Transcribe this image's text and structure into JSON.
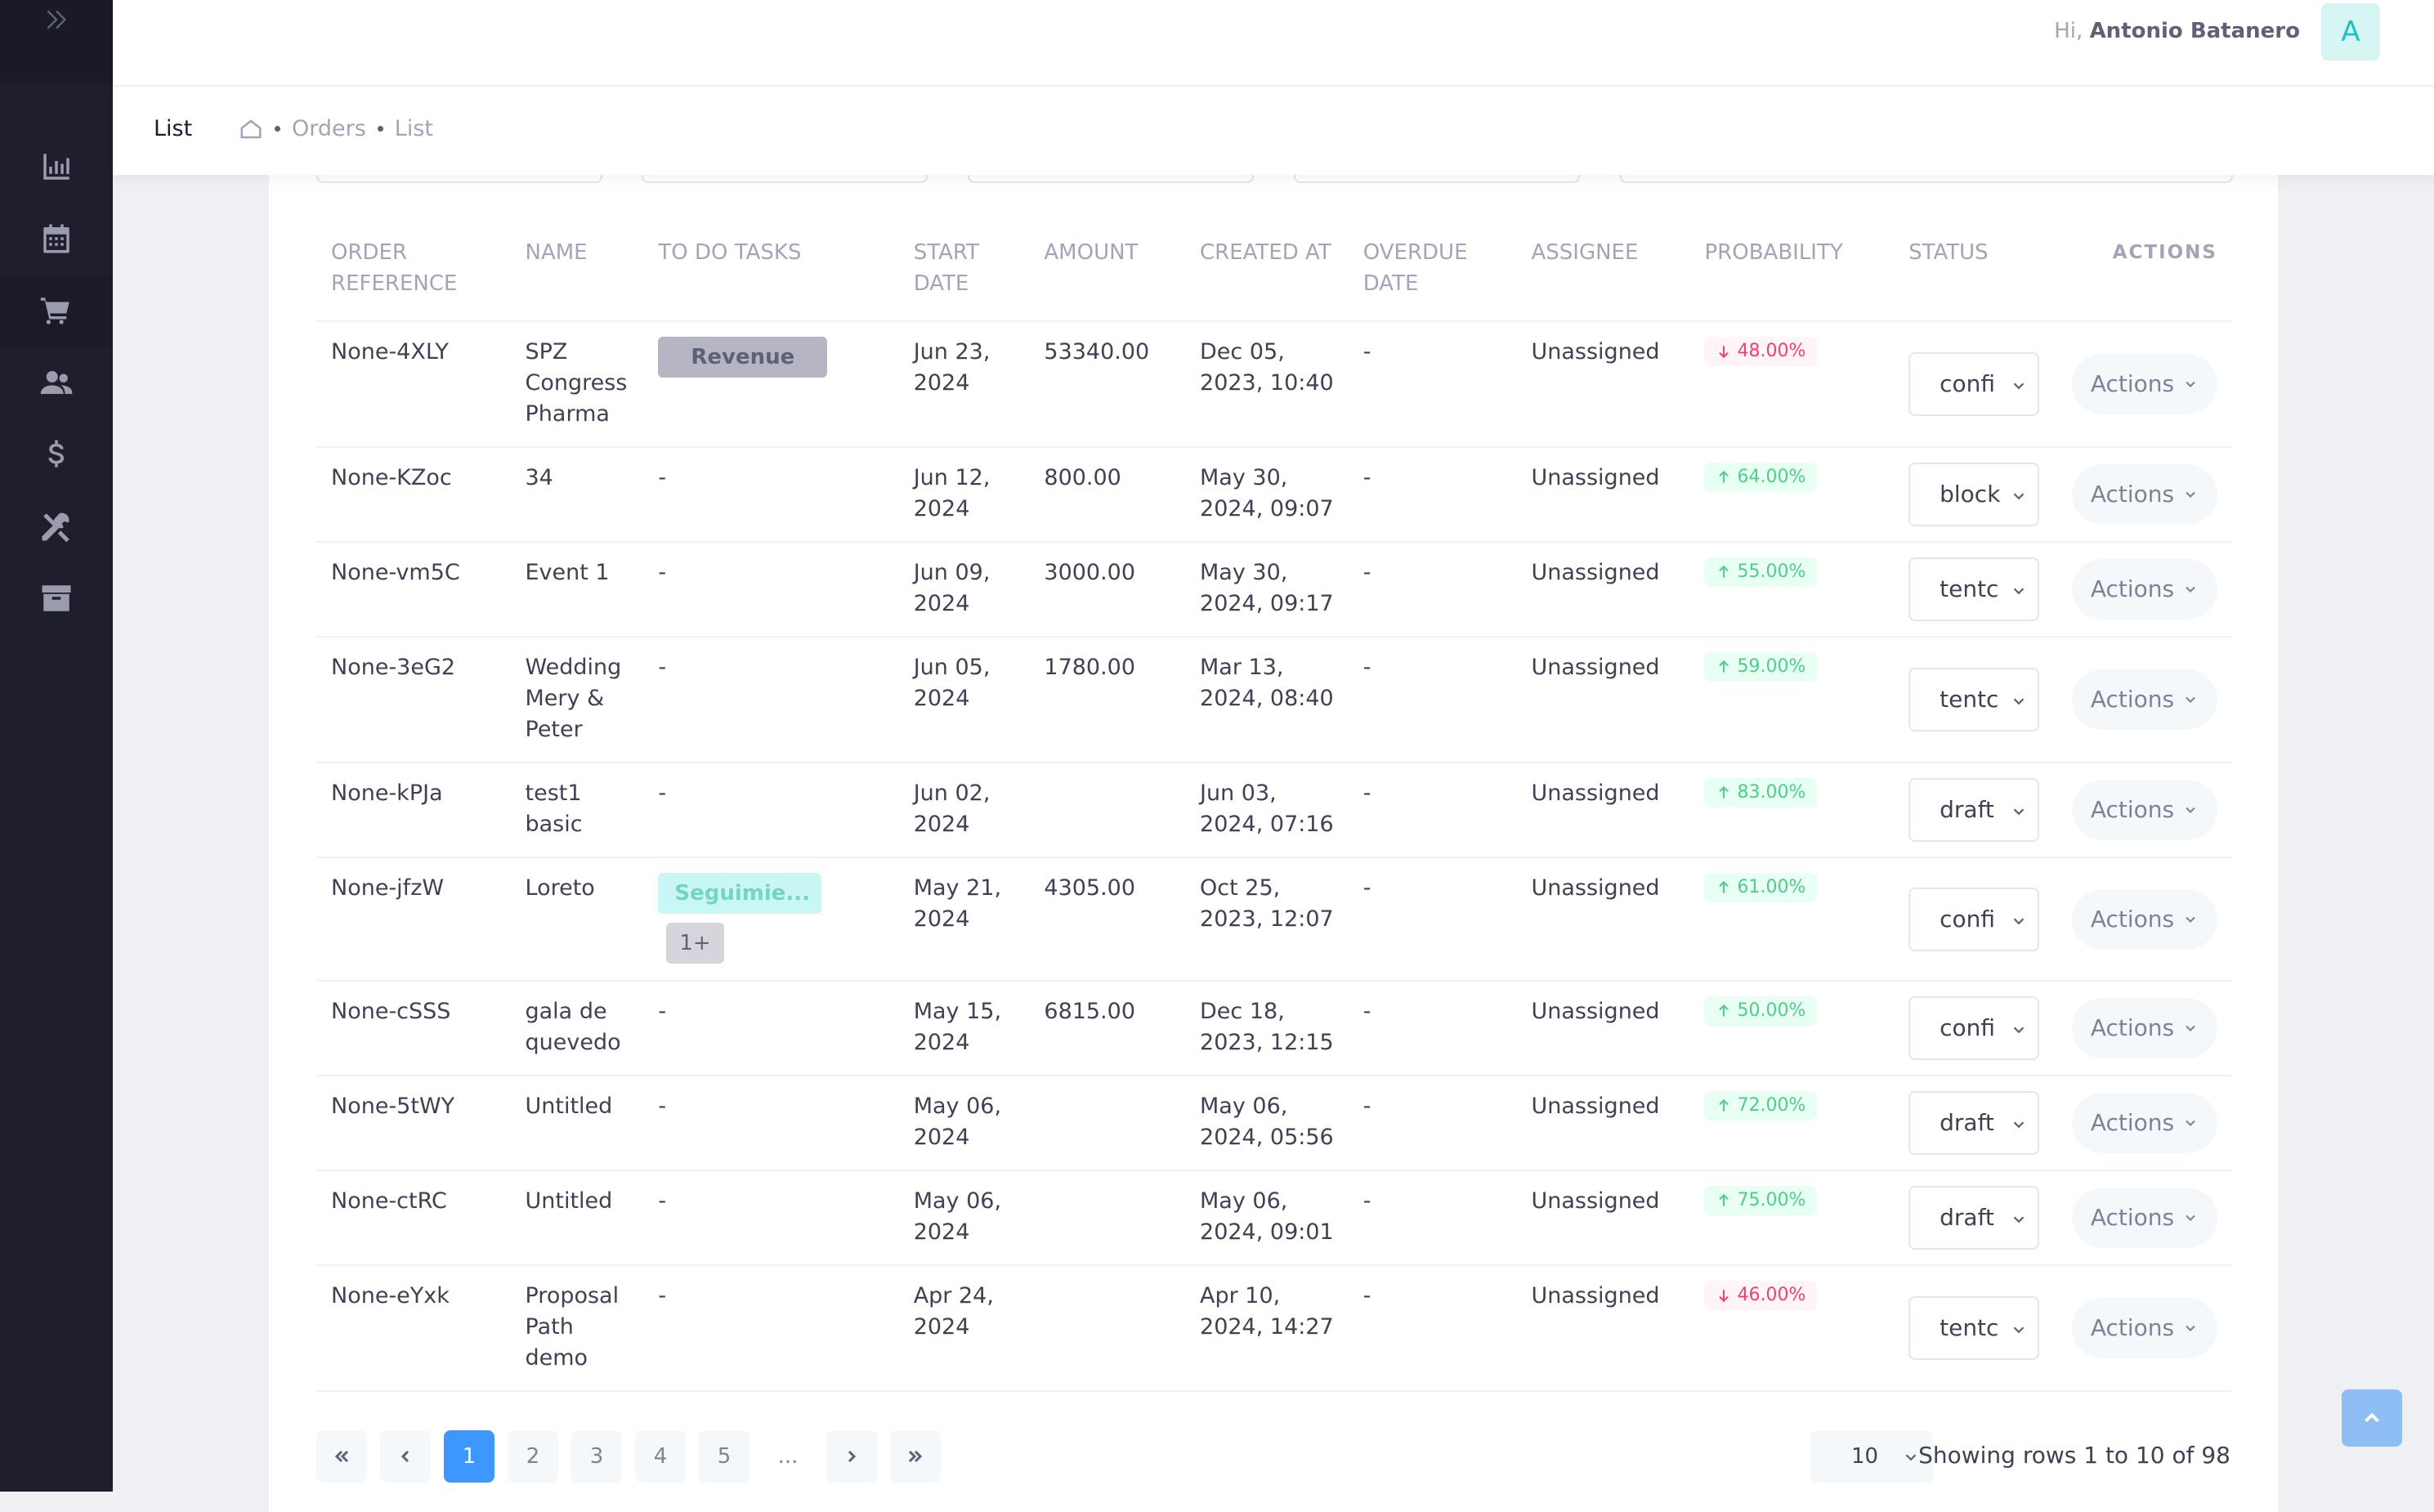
{
  "header": {
    "greeting_prefix": "Hi,",
    "user_name": "Antonio Batanero",
    "avatar_letter": "A"
  },
  "subheader": {
    "title": "List",
    "breadcrumb": [
      "Orders",
      "List"
    ]
  },
  "sidebar": {
    "items": [
      {
        "icon": "chart-bar-icon"
      },
      {
        "icon": "calendar-icon"
      },
      {
        "icon": "shopping-cart-icon"
      },
      {
        "icon": "users-icon"
      },
      {
        "icon": "dollar-icon"
      },
      {
        "icon": "tools-icon"
      },
      {
        "icon": "archive-icon"
      }
    ]
  },
  "table": {
    "columns": [
      "Order Reference",
      "Name",
      "To Do Tasks",
      "Start Date",
      "Amount",
      "Created At",
      "Overdue Date",
      "Assignee",
      "Probability",
      "Status",
      "Actions"
    ],
    "actions_label": "Actions",
    "rows": [
      {
        "ref": "None-4XLY",
        "name": "SPZ Congress Pharma",
        "task": "Revenue",
        "task_type": "rev",
        "extra": "",
        "start": "Jun 23, 2024",
        "amount": "53340.00",
        "created": "Dec 05, 2023, 10:40",
        "overdue": "-",
        "assignee": "Unassigned",
        "prob": "48.00%",
        "trend": "down",
        "status": "confi"
      },
      {
        "ref": "None-KZoc",
        "name": "34",
        "task": "-",
        "task_type": "",
        "extra": "",
        "start": "Jun 12, 2024",
        "amount": "800.00",
        "created": "May 30, 2024, 09:07",
        "overdue": "-",
        "assignee": "Unassigned",
        "prob": "64.00%",
        "trend": "up",
        "status": "block"
      },
      {
        "ref": "None-vm5C",
        "name": "Event 1",
        "task": "-",
        "task_type": "",
        "extra": "",
        "start": "Jun 09, 2024",
        "amount": "3000.00",
        "created": "May 30, 2024, 09:17",
        "overdue": "-",
        "assignee": "Unassigned",
        "prob": "55.00%",
        "trend": "up",
        "status": "tentc"
      },
      {
        "ref": "None-3eG2",
        "name": "Wedding Mery & Peter",
        "task": "-",
        "task_type": "",
        "extra": "",
        "start": "Jun 05, 2024",
        "amount": "1780.00",
        "created": "Mar 13, 2024, 08:40",
        "overdue": "-",
        "assignee": "Unassigned",
        "prob": "59.00%",
        "trend": "up",
        "status": "tentc"
      },
      {
        "ref": "None-kPJa",
        "name": "test1 basic",
        "task": "-",
        "task_type": "",
        "extra": "",
        "start": "Jun 02, 2024",
        "amount": "",
        "created": "Jun 03, 2024, 07:16",
        "overdue": "-",
        "assignee": "Unassigned",
        "prob": "83.00%",
        "trend": "up",
        "status": "draft"
      },
      {
        "ref": "None-jfzW",
        "name": "Loreto",
        "task": "Seguimie...",
        "task_type": "seg",
        "extra": "1+",
        "start": "May 21, 2024",
        "amount": "4305.00",
        "created": "Oct 25, 2023, 12:07",
        "overdue": "-",
        "assignee": "Unassigned",
        "prob": "61.00%",
        "trend": "up",
        "status": "confi"
      },
      {
        "ref": "None-cSSS",
        "name": "gala de quevedo",
        "task": "-",
        "task_type": "",
        "extra": "",
        "start": "May 15, 2024",
        "amount": "6815.00",
        "created": "Dec 18, 2023, 12:15",
        "overdue": "-",
        "assignee": "Unassigned",
        "prob": "50.00%",
        "trend": "up",
        "status": "confi"
      },
      {
        "ref": "None-5tWY",
        "name": "Untitled",
        "task": "-",
        "task_type": "",
        "extra": "",
        "start": "May 06, 2024",
        "amount": "",
        "created": "May 06, 2024, 05:56",
        "overdue": "-",
        "assignee": "Unassigned",
        "prob": "72.00%",
        "trend": "up",
        "status": "draft"
      },
      {
        "ref": "None-ctRC",
        "name": "Untitled",
        "task": "-",
        "task_type": "",
        "extra": "",
        "start": "May 06, 2024",
        "amount": "",
        "created": "May 06, 2024, 09:01",
        "overdue": "-",
        "assignee": "Unassigned",
        "prob": "75.00%",
        "trend": "up",
        "status": "draft"
      },
      {
        "ref": "None-eYxk",
        "name": "Proposal Path demo",
        "task": "-",
        "task_type": "",
        "extra": "",
        "start": "Apr 24, 2024",
        "amount": "",
        "created": "Apr 10, 2024, 14:27",
        "overdue": "-",
        "assignee": "Unassigned",
        "prob": "46.00%",
        "trend": "down",
        "status": "tentc"
      }
    ]
  },
  "pagination": {
    "pages": [
      "1",
      "2",
      "3",
      "4",
      "5"
    ],
    "current": "1",
    "ellipsis": "...",
    "per_page": "10",
    "summary": "Showing rows 1 to 10 of 98"
  },
  "colors": {
    "sidebar_bg": "#1e1e2d",
    "primary": "#3e97ff",
    "success": "#50cd89",
    "danger": "#f1416c"
  }
}
